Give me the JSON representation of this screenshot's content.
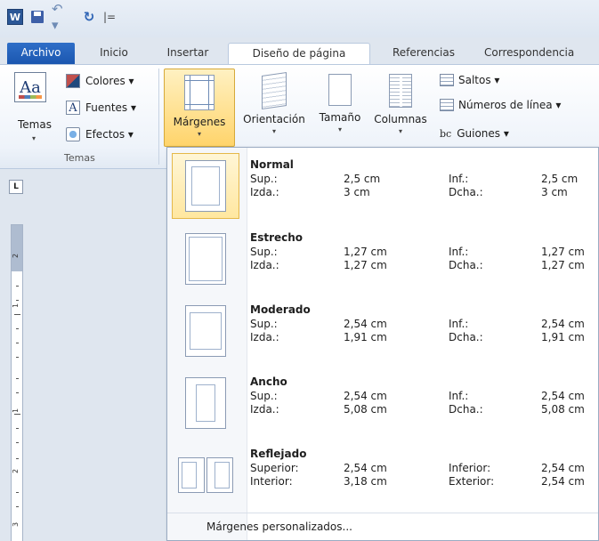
{
  "quick_access": {
    "word_label": "W",
    "separator": "|="
  },
  "tabs": [
    "Archivo",
    "Inicio",
    "Insertar",
    "Diseño de página",
    "Referencias",
    "Correspondencia"
  ],
  "ribbon": {
    "temas_label": "Temas",
    "temas_icon_text": "Aa",
    "colores": "Colores ▾",
    "fuentes": "Fuentes ▾",
    "efectos": "Efectos ▾",
    "fuentes_icon_text": "A",
    "group_temas": "Temas",
    "margenes": "Márgenes",
    "orientacion": "Orientación",
    "tamano": "Tamaño",
    "columnas": "Columnas",
    "saltos": "Saltos ▾",
    "numeros_linea": "Números de línea ▾",
    "guiones": "Guiones ▾",
    "guiones_icon_text": "bc"
  },
  "ruler": {
    "corner": "L",
    "numbers": [
      "2",
      "1",
      "1",
      "2",
      "3"
    ]
  },
  "margins_menu": {
    "items": [
      {
        "name": "Normal",
        "l1": "Sup.:",
        "v1": "2,5 cm",
        "l2": "Inf.:",
        "v2": "2,5 cm",
        "l3": "Izda.:",
        "v3": "3 cm",
        "l4": "Dcha.:",
        "v4": "3 cm"
      },
      {
        "name": "Estrecho",
        "l1": "Sup.:",
        "v1": "1,27 cm",
        "l2": "Inf.:",
        "v2": "1,27 cm",
        "l3": "Izda.:",
        "v3": "1,27 cm",
        "l4": "Dcha.:",
        "v4": "1,27 cm"
      },
      {
        "name": "Moderado",
        "l1": "Sup.:",
        "v1": "2,54 cm",
        "l2": "Inf.:",
        "v2": "2,54 cm",
        "l3": "Izda.:",
        "v3": "1,91 cm",
        "l4": "Dcha.:",
        "v4": "1,91 cm"
      },
      {
        "name": "Ancho",
        "l1": "Sup.:",
        "v1": "2,54 cm",
        "l2": "Inf.:",
        "v2": "2,54 cm",
        "l3": "Izda.:",
        "v3": "5,08 cm",
        "l4": "Dcha.:",
        "v4": "5,08 cm"
      },
      {
        "name": "Reflejado",
        "l1": "Superior:",
        "v1": "2,54 cm",
        "l2": "Inferior:",
        "v2": "2,54 cm",
        "l3": "Interior:",
        "v3": "3,18 cm",
        "l4": "Exterior:",
        "v4": "2,54 cm"
      }
    ],
    "custom": "Márgenes personalizados..."
  }
}
